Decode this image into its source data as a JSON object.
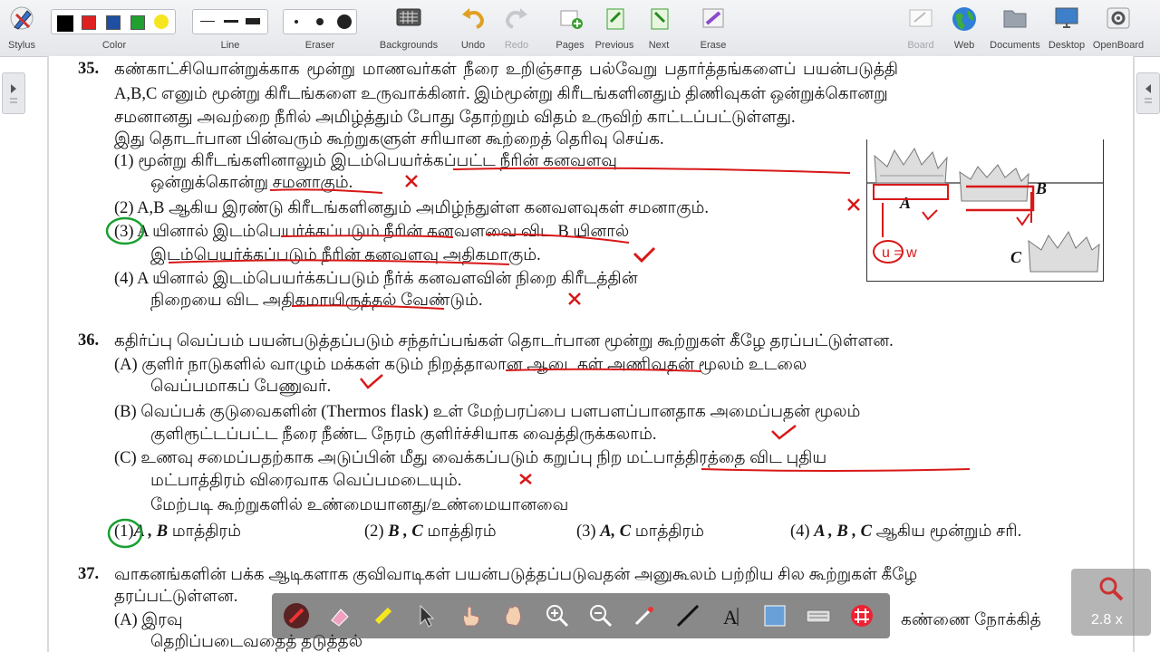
{
  "toolbar": {
    "stylus": "Stylus",
    "color": "Color",
    "line": "Line",
    "eraser": "Eraser",
    "backgrounds": "Backgrounds",
    "undo": "Undo",
    "redo": "Redo",
    "pages": "Pages",
    "previous": "Previous",
    "next": "Next",
    "erase": "Erase",
    "board": "Board",
    "web": "Web",
    "documents": "Documents",
    "desktop": "Desktop",
    "openboard": "OpenBoard",
    "swatches": [
      "#000000",
      "#e02020",
      "#1f4fa0",
      "#1fa030",
      "#f5e61e"
    ]
  },
  "q35": {
    "num": "35.",
    "l1": "கண்காட்சியொன்றுக்காக மூன்று மாணவர்கள் நீரை உறிஞ்சாத பல்வேறு பதார்த்தங்களைப் பயன்படுத்தி",
    "l2": "A,B,C எனும் மூன்று கிரீடங்களை உருவாக்கினர்.  இம்மூன்று கிரீடங்களினதும் திணிவுகள் ஒன்றுக்கொனறு",
    "l3": "சமனானது அவற்றை நீரில் அமிழ்த்தும் போது தோற்றும் விதம் உருவிற் காட்டப்பட்டுள்ளது.",
    "l4": "இது தொடர்பான பின்வரும் கூற்றுகளுள் சரியான கூற்றைத் தெரிவு செய்க.",
    "o1a": "(1) மூன்று  கிரீடங்களினாலும்  இடம்பெயர்க்கப்பட்ட  நீரின்  கனவளவு",
    "o1b": "ஒன்றுக்கொன்று சமனாகும்.",
    "o2": "(2) A,B ஆகிய இரண்டு கிரீடங்களினதும் அமிழ்ந்துள்ள கனவளவுகள் சமனாகும்.",
    "o3a": "(3) A  யினால்  இடம்பெயர்க்கப்படும்  நீரின்  கனவளவை  விட  B  யினால்",
    "o3b": "இடம்பெயர்க்கப்படும் நீரின் கனவளவு அதிகமாகும்.",
    "o4a": "(4) A  யினால்  இடம்பெயர்க்கப்படும்  நீர்க்  கனவளவின்  நிறை  கிரீடத்தின்",
    "o4b": "நிறையை விட அதிகமாயிருத்தல்  வேண்டும்.",
    "fig_a": "A",
    "fig_b": "B",
    "fig_c": "C",
    "ink_note": "u = w"
  },
  "q36": {
    "num": "36.",
    "intro": "கதிர்ப்பு வெப்பம் பயன்படுத்தப்படும் சந்தர்ப்பங்கள் தொடர்பான மூன்று கூற்றுகள் கீழே தரப்பட்டுள்ளன.",
    "a1": "(A) குளிர்  நாடுகளில்  வாழும்  மக்கள்  கடும்  நிறத்தாலான  ஆடைகள்  அணிவதன்  மூலம்  உடலை",
    "a2": "வெப்பமாகப் பேணுவர்.",
    "b1": "(B) வெப்பக்  குடுவைகளின்  (Thermos  flask)  உள்  மேற்பரப்பை  பளபளப்பானதாக  அமைப்பதன்  மூலம்",
    "b2": "குளிரூட்டப்பட்ட நீரை நீண்ட நேரம் குளிர்ச்சியாக வைத்திருக்கலாம்.",
    "c1": "(C) உணவு  சமைப்பதற்காக  அடுப்பின்  மீது  வைக்கப்படும்  கறுப்பு  நிற  மட்பாத்திரத்தை  விட  புதிய",
    "c2": "மட்பாத்திரம் விரைவாக வெப்பமடையும்.",
    "q": "மேற்படி கூற்றுகளில் உண்மையானது/உண்மையானவை",
    "opt1": "(1)",
    "opt1b": "A , B",
    "opt1c": "மாத்திரம்",
    "opt2": "(2)",
    "opt2b": "B , C",
    "opt2c": "மாத்திரம்",
    "opt3": "(3)",
    "opt3b": "A, C",
    "opt3c": "மாத்திரம்",
    "opt4": "(4)",
    "opt4b": "A , B , C",
    "opt4c": "ஆகிய மூன்றும் சரி."
  },
  "q37": {
    "num": "37.",
    "l1": "வாகனங்களின் பக்க ஆடிகளாக குவிவாடிகள் பயன்படுத்தப்படுவதன் அனுகூலம் பற்றிய சில கூற்றுகள் கீழே",
    "l2": "தரப்பட்டுள்ளன.",
    "l3a": "(A) இரவு",
    "l3b": "கண்ணை    நோக்கித்",
    "l4": "தெறிப்படைவதைத் தடுத்தல்"
  },
  "zoom": {
    "label": "2.8 x"
  }
}
